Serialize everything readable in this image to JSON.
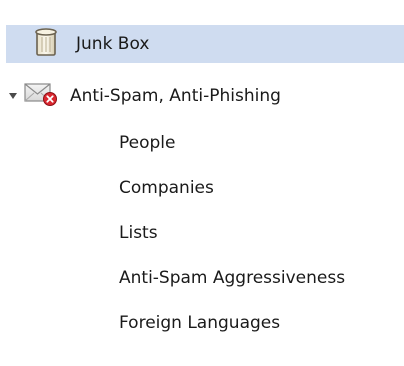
{
  "tree": {
    "items": [
      {
        "label": "Junk Box",
        "icon": "trash-can-icon",
        "selected": true,
        "level": 0
      },
      {
        "label": "Anti-Spam, Anti-Phishing",
        "icon": "envelope-blocked-icon",
        "expanded": true,
        "expander_icon": "triangle-down-icon",
        "level": 0,
        "children": [
          {
            "label": "People"
          },
          {
            "label": "Companies"
          },
          {
            "label": "Lists"
          },
          {
            "label": "Anti-Spam Aggressiveness"
          },
          {
            "label": "Foreign Languages"
          }
        ]
      }
    ]
  },
  "colors": {
    "selection_background": "#cfdcf0",
    "delete_badge": "#d9262e"
  }
}
